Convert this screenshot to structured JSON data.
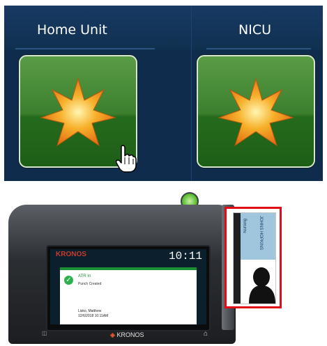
{
  "units": [
    {
      "label": "Home Unit",
      "selected": true
    },
    {
      "label": "NICU",
      "selected": false
    }
  ],
  "device": {
    "brand": "KRONOS",
    "screen": {
      "brand": "KRONOS",
      "clock": "10:11",
      "status_title": "ATR In",
      "status_sub": "Punch Created",
      "employee": "Lisko, Matthew",
      "timestamp": "12/6/2018 10:11AM"
    }
  },
  "badge": {
    "institution": "JOHNS HOPKINS",
    "role": "Nursing"
  },
  "colors": {
    "panel_bg": "#0f2c4c",
    "tile_green": "#2f7a26",
    "star_orange": "#f39a1e",
    "highlight_red": "#e10c17"
  },
  "icons": {
    "tile_icon": "star-icon",
    "pointer": "hand-cursor-icon",
    "success": "checkmark-icon"
  }
}
